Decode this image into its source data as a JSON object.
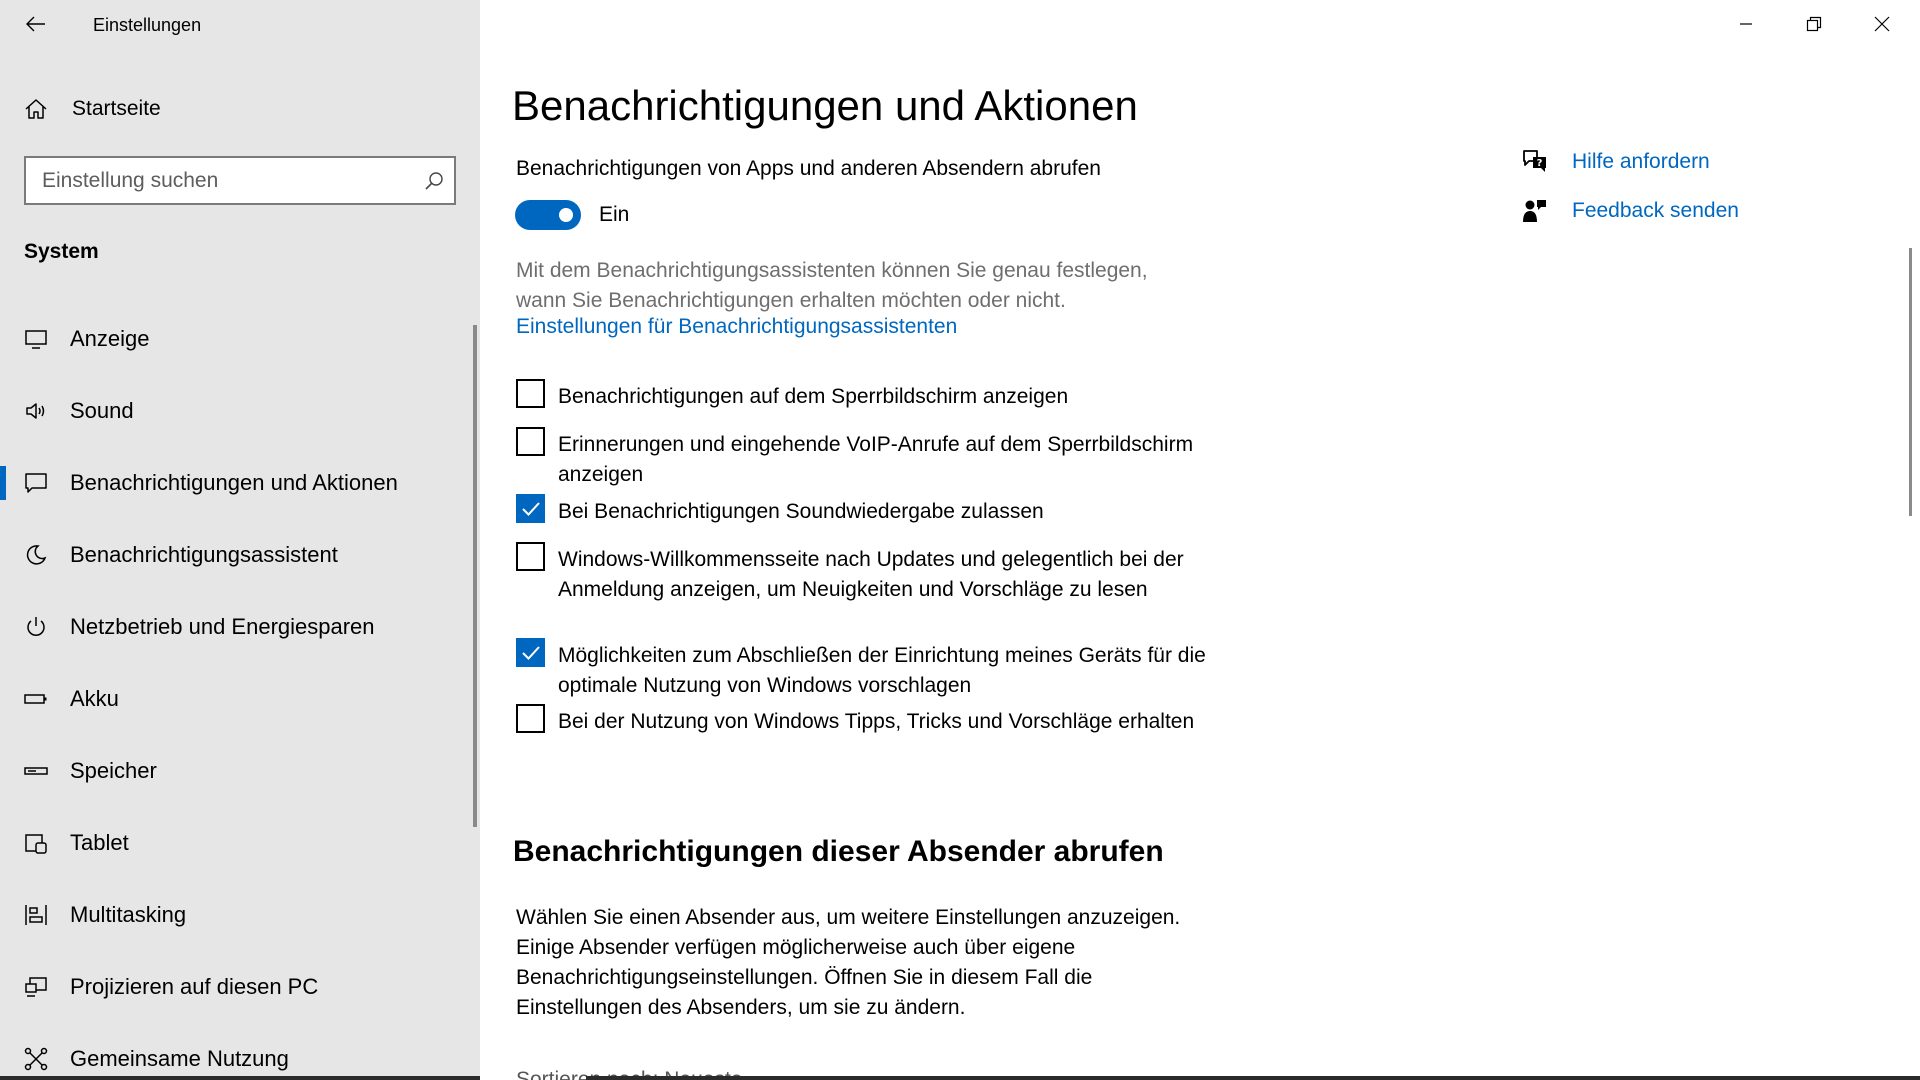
{
  "window": {
    "title": "Einstellungen",
    "controls": [
      "minimize-icon",
      "restore-icon",
      "close-icon"
    ]
  },
  "sidebar": {
    "home_label": "Startseite",
    "search_placeholder": "Einstellung suchen",
    "section_label": "System",
    "items": [
      {
        "label": "Anzeige",
        "icon": "display-icon"
      },
      {
        "label": "Sound",
        "icon": "speaker-icon"
      },
      {
        "label": "Benachrichtigungen und Aktionen",
        "icon": "notification-icon",
        "active": true
      },
      {
        "label": "Benachrichtigungsassistent",
        "icon": "moon-icon"
      },
      {
        "label": "Netzbetrieb und Energiesparen",
        "icon": "power-icon"
      },
      {
        "label": "Akku",
        "icon": "battery-icon"
      },
      {
        "label": "Speicher",
        "icon": "storage-icon"
      },
      {
        "label": "Tablet",
        "icon": "tablet-icon"
      },
      {
        "label": "Multitasking",
        "icon": "multitasking-icon"
      },
      {
        "label": "Projizieren auf diesen PC",
        "icon": "project-icon"
      },
      {
        "label": "Gemeinsame Nutzung",
        "icon": "share-icon"
      }
    ]
  },
  "main": {
    "title": "Benachrichtigungen und Aktionen",
    "notifications_heading": "Benachrichtigungen von Apps und anderen Absendern abrufen",
    "toggle_state": "Ein",
    "description": "Mit dem Benachrichtigungsassistenten können Sie genau festlegen, wann Sie Benachrichtigungen erhalten möchten oder nicht.",
    "assistant_link": "Einstellungen für Benachrichtigungsassistenten",
    "checkboxes": [
      {
        "label": "Benachrichtigungen auf dem Sperrbildschirm anzeigen",
        "checked": false
      },
      {
        "label": "Erinnerungen und eingehende VoIP-Anrufe auf dem Sperrbildschirm anzeigen",
        "checked": false
      },
      {
        "label": "Bei Benachrichtigungen Soundwiedergabe zulassen",
        "checked": true
      },
      {
        "label": "Windows-Willkommensseite nach Updates und gelegentlich bei der Anmeldung anzeigen, um Neuigkeiten und Vorschläge zu lesen",
        "checked": false
      },
      {
        "label": "Möglichkeiten zum Abschließen der Einrichtung meines Geräts für die optimale Nutzung von Windows vorschlagen",
        "checked": true
      },
      {
        "label": "Bei der Nutzung von Windows Tipps, Tricks und Vorschläge erhalten",
        "checked": false
      }
    ],
    "section2_title": "Benachrichtigungen dieser Absender abrufen",
    "section2_text": "Wählen Sie einen Absender aus, um weitere Einstellungen anzuzeigen. Einige Absender verfügen möglicherweise auch über eigene Benachrichtigungseinstellungen. Öffnen Sie in diesem Fall die Einstellungen des Absenders, um sie zu ändern.",
    "sort_peek": "Sortieren nach: Neueste"
  },
  "help": {
    "get_help": "Hilfe anfordern",
    "feedback": "Feedback senden"
  },
  "colors": {
    "accent": "#0067c0",
    "sidebar_bg": "#e6e6e6"
  }
}
